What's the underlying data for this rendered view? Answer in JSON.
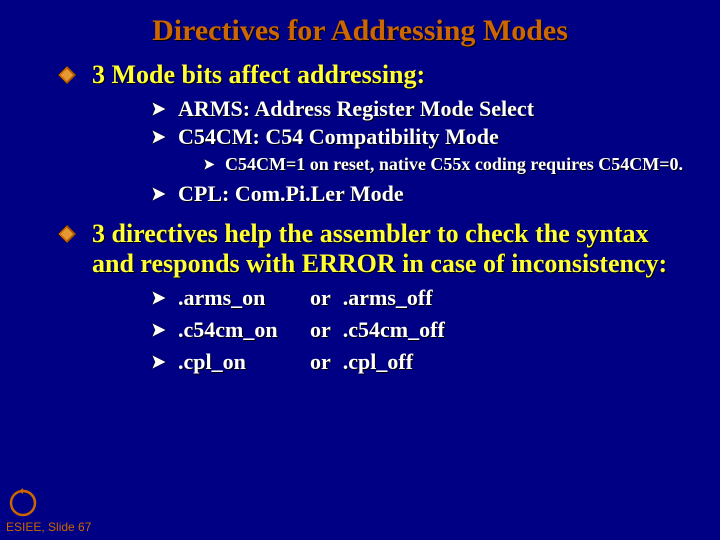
{
  "title": "Directives for Addressing Modes",
  "level1": {
    "a": "3 Mode bits affect addressing:",
    "b": "3 directives help the assembler to check the syntax and responds with ERROR in case of inconsistency:"
  },
  "mode_bits": {
    "arms": "ARMS: Address Register Mode Select",
    "c54cm": "C54CM: C54 Compatibility Mode",
    "c54cm_note": "C54CM=1 on reset, native C55x coding requires C54CM=0.",
    "cpl": "CPL: Com.Pi.Ler Mode"
  },
  "directives": {
    "col_on": [
      ".arms_on",
      ".c54cm_on",
      ".cpl_on"
    ],
    "col_or": [
      "or",
      "or",
      "or"
    ],
    "col_off": [
      ".arms_off",
      ".c54cm_off",
      ".cpl_off"
    ]
  },
  "footer": "ESIEE, Slide 67",
  "colors": {
    "bg": "#000084",
    "title": "#cc6600",
    "l1": "#ffff33",
    "body": "#ffffff"
  }
}
